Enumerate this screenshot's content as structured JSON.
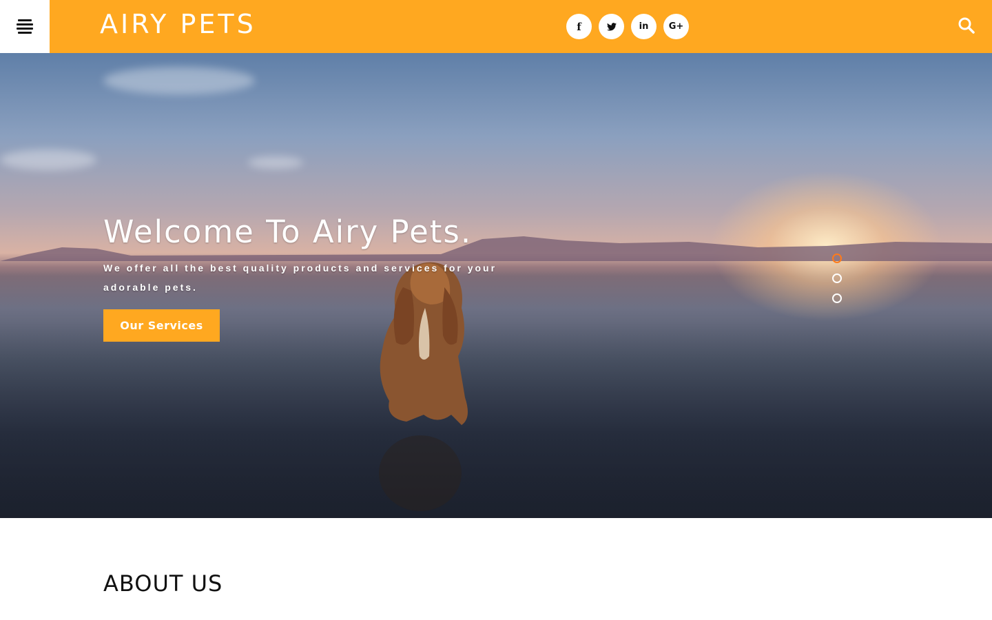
{
  "header": {
    "logo_text": "AIRY PETS",
    "social": [
      {
        "icon": "facebook-icon",
        "glyph": "f"
      },
      {
        "icon": "twitter-icon",
        "glyph": "🐦"
      },
      {
        "icon": "linkedin-icon",
        "glyph": "in"
      },
      {
        "icon": "google-plus-icon",
        "glyph": "G+"
      }
    ],
    "menu_icon": "hamburger-menu-icon",
    "search_icon": "search-icon"
  },
  "hero": {
    "title": "Welcome To Airy Pets.",
    "subtitle": "We offer all the best quality products and services for your adorable pets.",
    "cta_label": "Our Services",
    "slide_count": 3,
    "active_slide": 1
  },
  "about": {
    "title": "ABOUT US"
  },
  "colors": {
    "accent": "#ffa820",
    "active_dot": "#ff7a1a",
    "white": "#ffffff",
    "heading": "#111111"
  }
}
